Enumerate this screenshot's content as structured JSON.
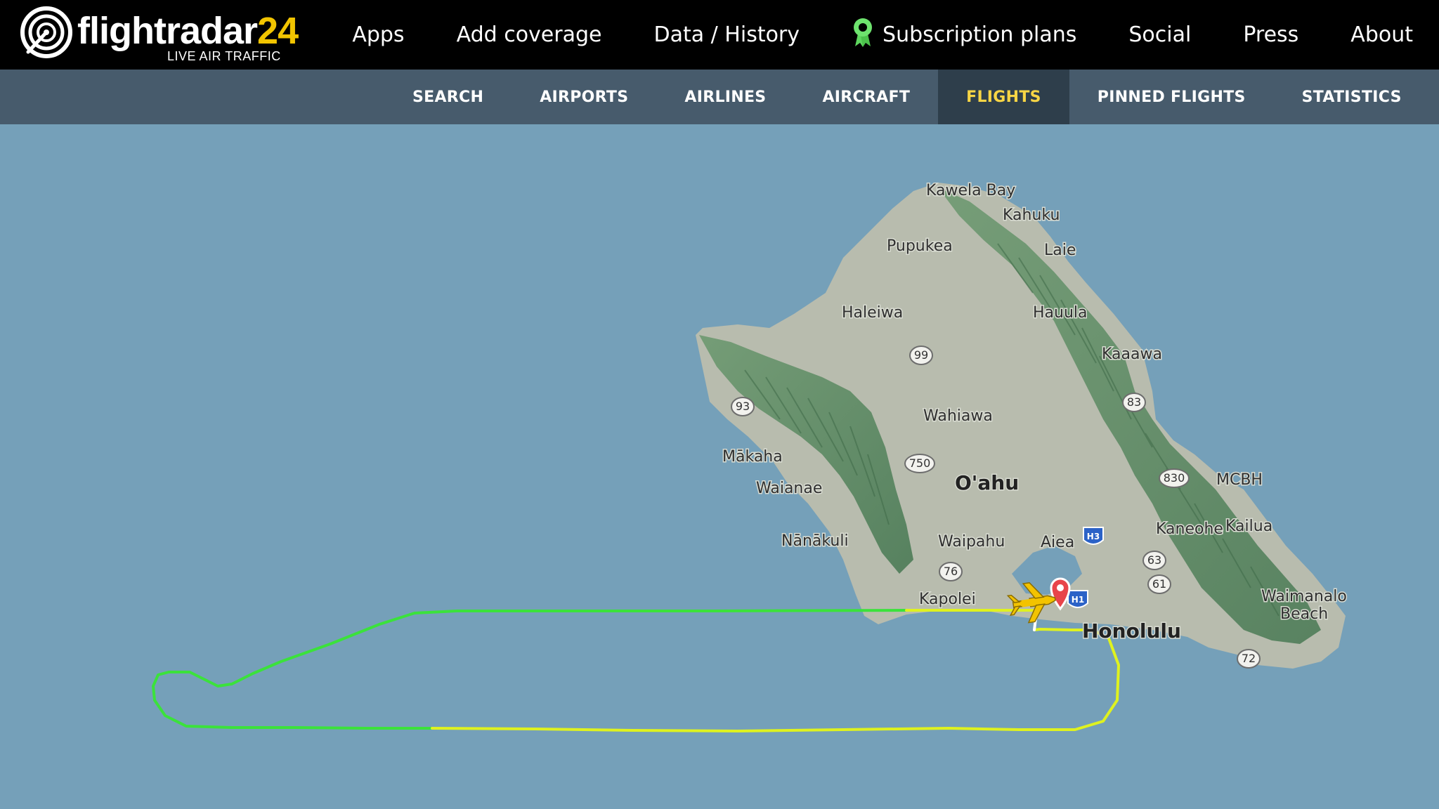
{
  "brand": {
    "name_main": "flightradar",
    "name_num": "24",
    "tagline": "LIVE AIR TRAFFIC"
  },
  "topnav": [
    {
      "label": "Apps"
    },
    {
      "label": "Add coverage"
    },
    {
      "label": "Data / History"
    },
    {
      "label": "Subscription plans",
      "icon": "award-icon"
    },
    {
      "label": "Social"
    },
    {
      "label": "Press"
    },
    {
      "label": "About"
    }
  ],
  "subnav": [
    {
      "label": "SEARCH"
    },
    {
      "label": "AIRPORTS"
    },
    {
      "label": "AIRLINES"
    },
    {
      "label": "AIRCRAFT"
    },
    {
      "label": "FLIGHTS",
      "active": true
    },
    {
      "label": "PINNED FLIGHTS"
    },
    {
      "label": "STATISTICS"
    }
  ],
  "map": {
    "island": "O'ahu",
    "places": {
      "kawela_bay": "Kawela Bay",
      "kahuku": "Kahuku",
      "pupukea": "Pupukea",
      "laie": "Laie",
      "haleiwa": "Haleiwa",
      "hauula": "Hauula",
      "kaaawa": "Kaaawa",
      "wahiawa": "Wahiawa",
      "makaha": "Mākaha",
      "waianae": "Waianae",
      "mcbh": "MCBH",
      "kaneohe": "Kaneohe",
      "kailua": "Kailua",
      "nanakuli": "Nānākuli",
      "waipahu": "Waipahu",
      "aiea": "Aiea",
      "kapolei": "Kapolei",
      "honolulu": "Honolulu",
      "waimanalo": "Waimanalo",
      "beach": "Beach"
    },
    "routes": {
      "r99": "99",
      "r93": "93",
      "r83": "83",
      "r750": "750",
      "r830": "830",
      "r63": "63",
      "r61": "61",
      "r76": "76",
      "r72": "72",
      "h3": "H3",
      "h1": "H1"
    },
    "colors": {
      "water": "#75a0b9",
      "land": "#b8bcae",
      "terrain": "#5f8a66",
      "track_green": "#3be23b",
      "track_yellow": "#dff21f",
      "aircraft": "#f3c300",
      "airport_marker": "#e8444a"
    }
  }
}
